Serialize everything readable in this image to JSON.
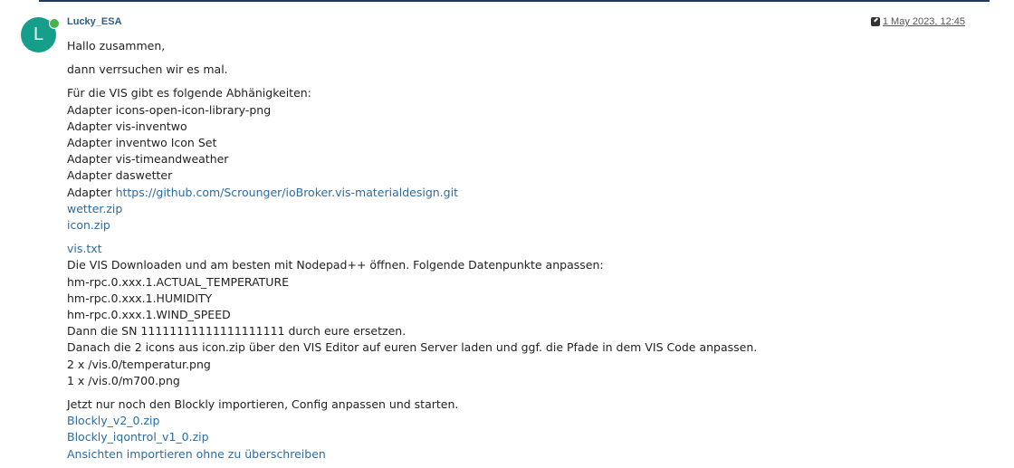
{
  "post": {
    "author": "Lucky_ESA",
    "avatar_letter": "L",
    "timestamp": "1 May 2023, 12:45"
  },
  "content": {
    "greeting": "Hallo zusammen,",
    "intro": "dann verrsuchen wir es mal.",
    "dependencies_heading": "Für die VIS gibt es folgende Abhänigkeiten:",
    "dep1": "Adapter icons-open-icon-library-png",
    "dep2": "Adapter vis-inventwo",
    "dep3": "Adapter inventwo Icon Set",
    "dep4": "Adapter vis-timeandweather",
    "dep5": "Adapter daswetter",
    "dep6_prefix": "Adapter ",
    "dep6_link": "https://github.com/Scrounger/ioBroker.vis-materialdesign.git",
    "link_wetter": "wetter.zip",
    "link_icon": "icon.zip",
    "link_vis": "vis.txt",
    "instr1": "Die VIS Downloaden und am besten mit Nodepad++ öffnen. Folgende Datenpunkte anpassen:",
    "dp1": "hm-rpc.0.xxx.1.ACTUAL_TEMPERATURE",
    "dp2": "hm-rpc.0.xxx.1.HUMIDITY",
    "dp3": "hm-rpc.0.xxx.1.WIND_SPEED",
    "instr2": "Dann die SN 11111111111111111111 durch eure ersetzen.",
    "instr3": "Danach die 2 icons aus icon.zip über den VIS Editor auf euren Server laden und ggf. die Pfade in dem VIS Code anpassen.",
    "path1": "2 x /vis.0/temperatur.png",
    "path2": "1 x /vis.0/m700.png",
    "instr4": "Jetzt nur noch den Blockly importieren, Config anpassen und starten.",
    "link_blockly1": "Blockly_v2_0.zip",
    "link_blockly2": "Blockly_iqontrol_v1_0.zip",
    "link_views": "Ansichten importieren ohne zu überschreiben"
  },
  "colors": {
    "link": "#2d6ba0",
    "author": "#2d5d8d",
    "avatar": "#159f8a",
    "online": "#4caf50"
  }
}
